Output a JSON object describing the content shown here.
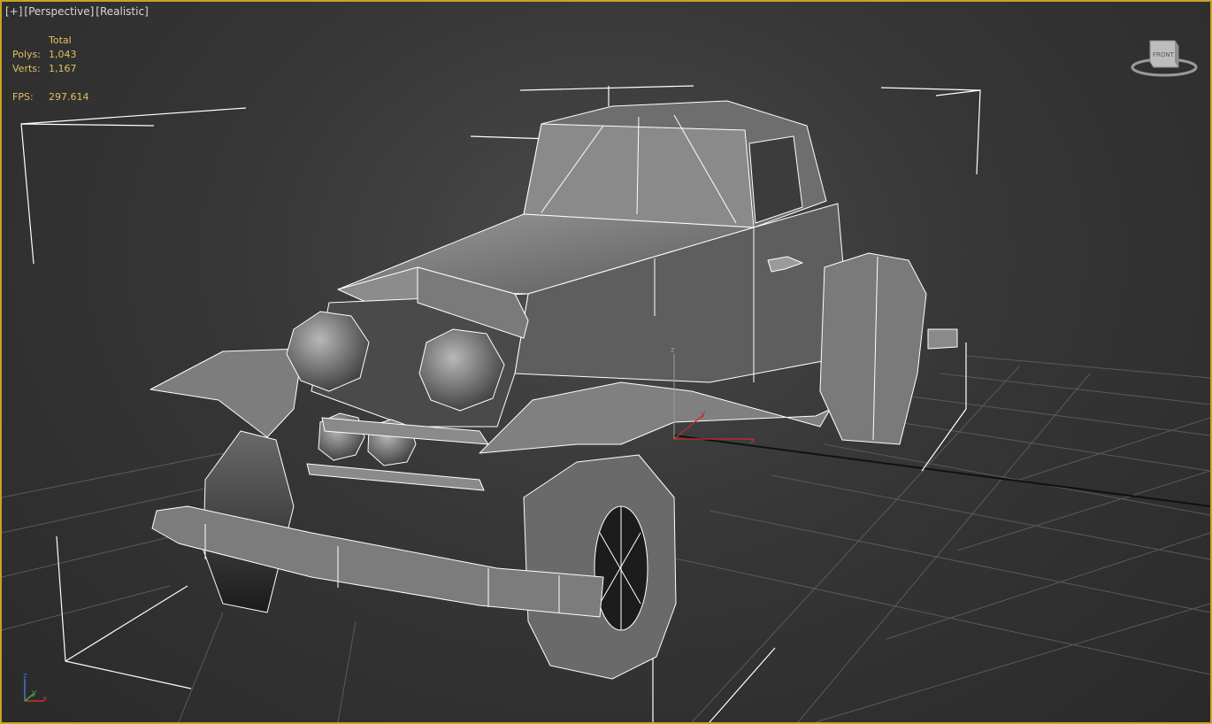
{
  "viewport": {
    "plus_label": "[+]",
    "view_label": "[Perspective]",
    "shading_label": "[Realistic]"
  },
  "stats": {
    "header": "Total",
    "polys_label": "Polys:",
    "polys_value": "1,043",
    "verts_label": "Verts:",
    "verts_value": "1,167",
    "fps_label": "FPS:",
    "fps_value": "297.614"
  },
  "viewcube": {
    "face_label": "FRONT"
  },
  "gizmo": {
    "x": "x",
    "y": "y",
    "z": "z"
  },
  "axis_tripod": {
    "x": "x",
    "y": "y",
    "z": "z"
  },
  "colors": {
    "border_active": "#c9a227",
    "stats_text": "#e0c060",
    "grid": "#555555",
    "wire": "#ffffff"
  }
}
